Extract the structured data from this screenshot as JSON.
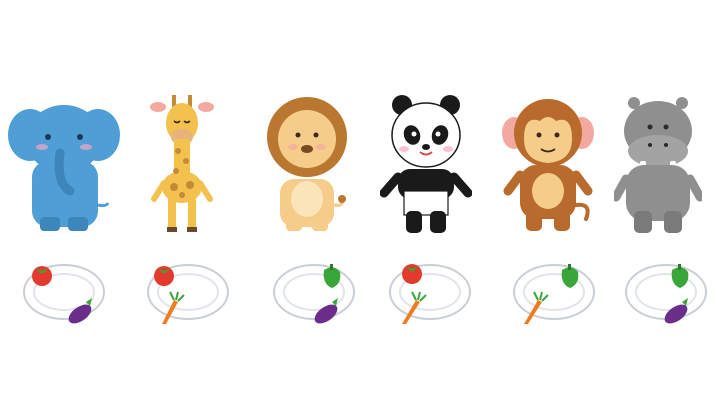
{
  "scene": {
    "animals": [
      {
        "name": "elephant",
        "icon": "elephant-icon",
        "plate": [
          "tomato",
          "eggplant"
        ]
      },
      {
        "name": "giraffe",
        "icon": "giraffe-icon",
        "plate": [
          "tomato",
          "carrot"
        ]
      },
      {
        "name": "lion",
        "icon": "lion-icon",
        "plate": [
          "green-pepper",
          "eggplant"
        ]
      },
      {
        "name": "panda",
        "icon": "panda-icon",
        "plate": [
          "tomato",
          "carrot"
        ]
      },
      {
        "name": "monkey",
        "icon": "monkey-icon",
        "plate": [
          "green-pepper",
          "carrot"
        ]
      },
      {
        "name": "hippo",
        "icon": "hippo-icon",
        "plate": [
          "green-pepper",
          "eggplant"
        ]
      }
    ]
  },
  "colors": {
    "elephant": "#4f9fd6",
    "giraffe": "#f2c14e",
    "lion_mane": "#b9772f",
    "lion_body": "#f6cc8a",
    "panda_black": "#1a1a1a",
    "monkey": "#b86b2d",
    "hippo": "#8f8f8f",
    "tomato": "#e23b2e",
    "carrot": "#ee7d20",
    "pepper": "#3aa63a",
    "eggplant": "#6a2d8a"
  }
}
